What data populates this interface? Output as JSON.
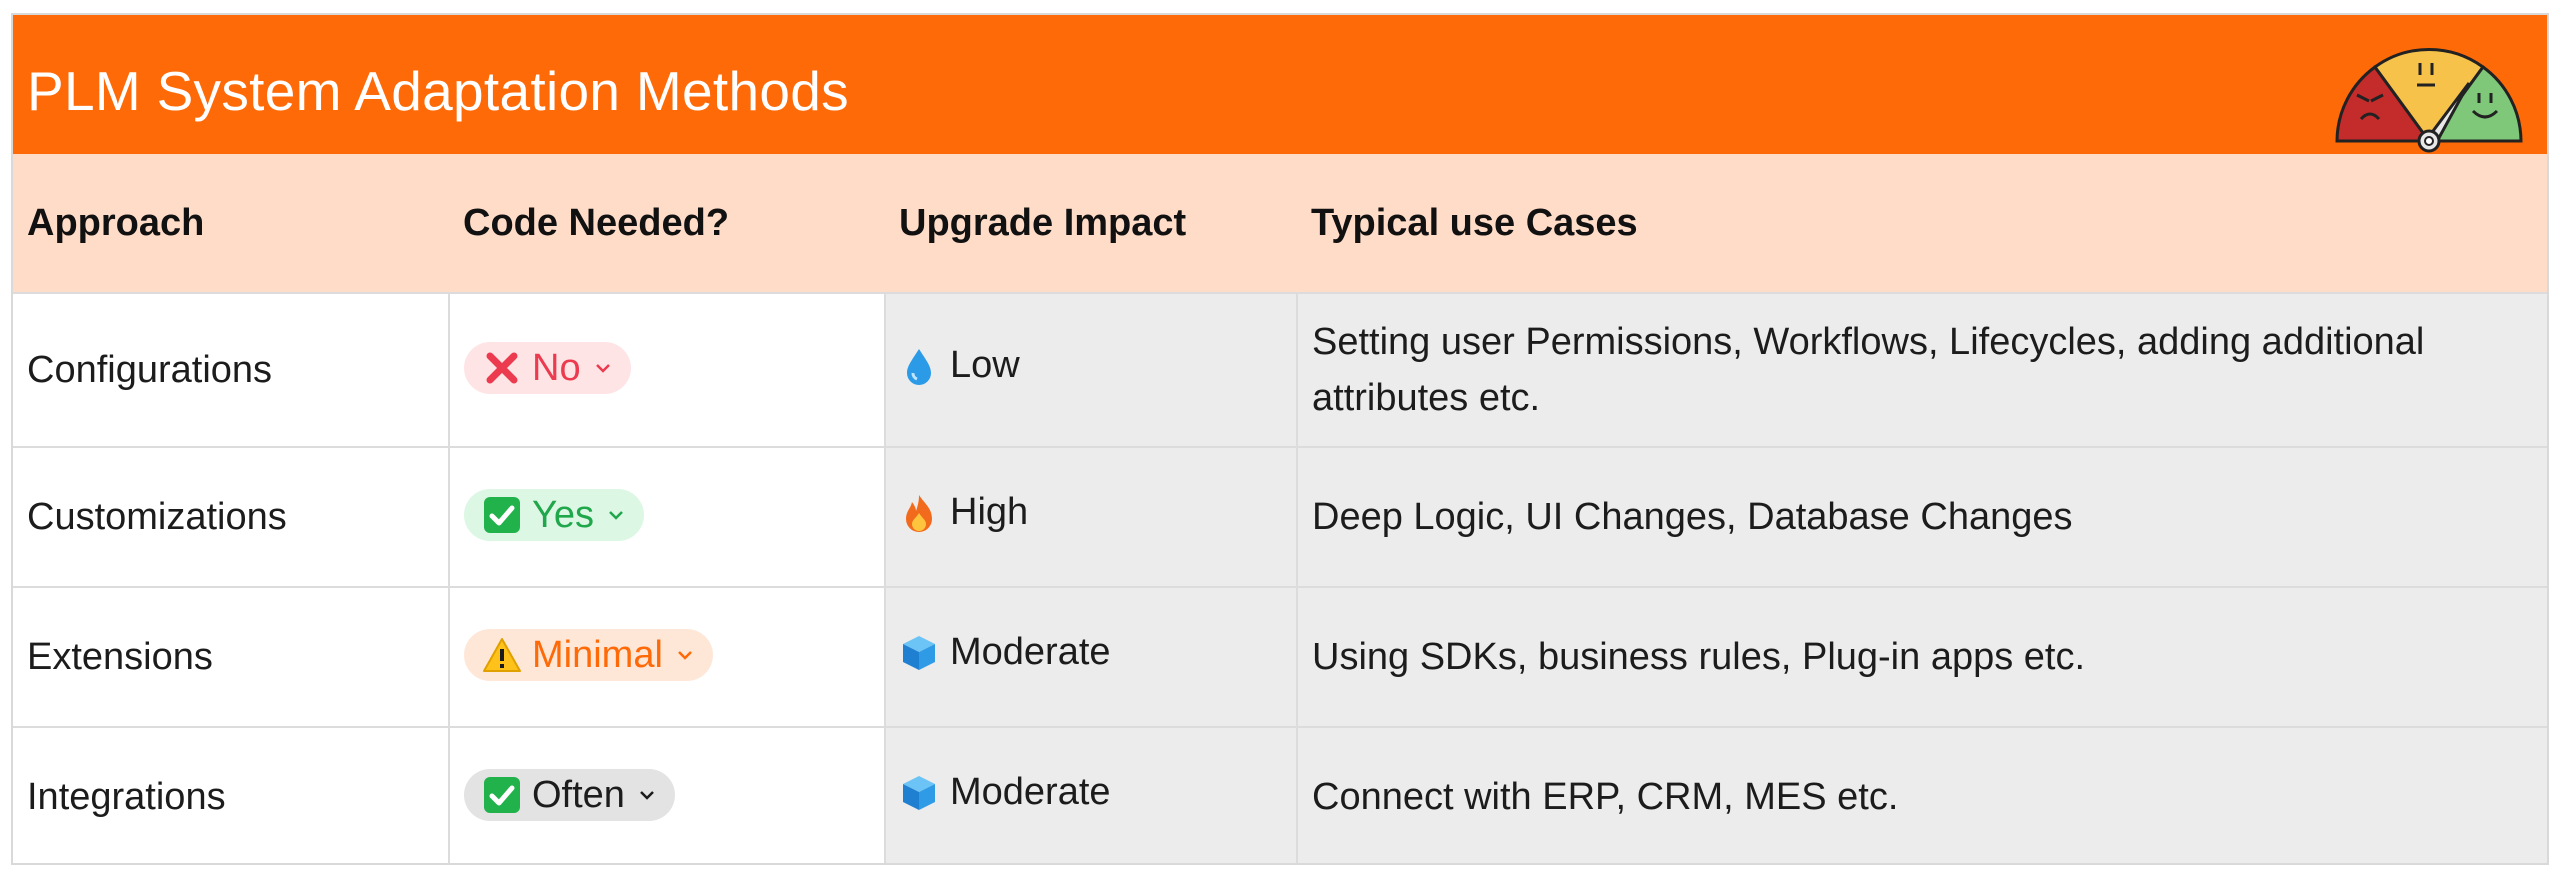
{
  "title": "PLM System Adaptation Methods",
  "headers": {
    "approach": "Approach",
    "code": "Code Needed?",
    "impact": "Upgrade Impact",
    "cases": "Typical use Cases"
  },
  "rows": [
    {
      "approach": "Configurations",
      "code": "No",
      "code_icon": "red-cross-icon",
      "impact": "Low",
      "impact_icon": "droplet-icon",
      "cases": "Setting user Permissions, Workflows, Lifecycles, adding additional attributes etc."
    },
    {
      "approach": "Customizations",
      "code": "Yes",
      "code_icon": "green-check-icon",
      "impact": "High",
      "impact_icon": "fire-icon",
      "cases": "Deep Logic, UI Changes, Database Changes"
    },
    {
      "approach": "Extensions",
      "code": "Minimal",
      "code_icon": "warning-icon",
      "impact": "Moderate",
      "impact_icon": "cube-icon",
      "cases": "Using SDKs, business rules, Plug-in apps etc."
    },
    {
      "approach": "Integrations",
      "code": "Often",
      "code_icon": "green-check-icon",
      "impact": "Moderate",
      "impact_icon": "cube-icon",
      "cases": "Connect with ERP, CRM, MES etc."
    }
  ],
  "colors": {
    "title_bar": "#ff6a08",
    "header_row": "#ffdcc8",
    "no_pill": "#ffe4e6",
    "yes_pill": "#dcf7e4",
    "minimal_pill": "#ffe7d8",
    "often_pill": "#e3e3e3"
  }
}
